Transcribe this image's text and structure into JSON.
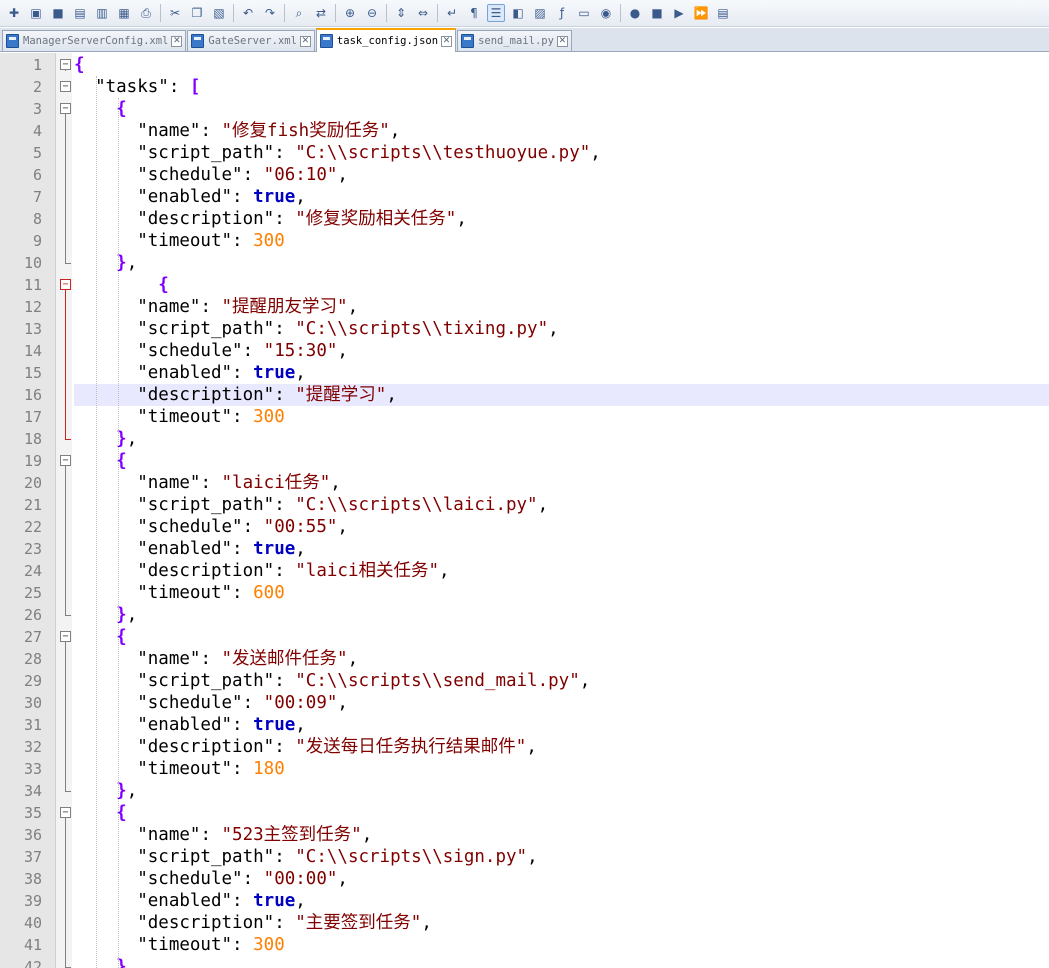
{
  "toolbar": {
    "buttons": [
      {
        "icon": "new-file-icon",
        "glyph": "✚"
      },
      {
        "icon": "open-file-icon",
        "glyph": "▣"
      },
      {
        "icon": "save-icon",
        "glyph": "■"
      },
      {
        "icon": "save-all-icon",
        "glyph": "▤"
      },
      {
        "icon": "close-icon",
        "glyph": "▥"
      },
      {
        "icon": "close-all-icon",
        "glyph": "▦"
      },
      {
        "icon": "print-icon",
        "glyph": "⎙"
      },
      {
        "sep": true
      },
      {
        "icon": "cut-icon",
        "glyph": "✂"
      },
      {
        "icon": "copy-icon",
        "glyph": "❐"
      },
      {
        "icon": "paste-icon",
        "glyph": "▧"
      },
      {
        "sep": true
      },
      {
        "icon": "undo-icon",
        "glyph": "↶"
      },
      {
        "icon": "redo-icon",
        "glyph": "↷"
      },
      {
        "sep": true
      },
      {
        "icon": "find-icon",
        "glyph": "⌕"
      },
      {
        "icon": "replace-icon",
        "glyph": "⇄"
      },
      {
        "sep": true
      },
      {
        "icon": "zoom-in-icon",
        "glyph": "⊕"
      },
      {
        "icon": "zoom-out-icon",
        "glyph": "⊖"
      },
      {
        "sep": true
      },
      {
        "icon": "sync-vertical-icon",
        "glyph": "⇕"
      },
      {
        "icon": "sync-horizontal-icon",
        "glyph": "⇔"
      },
      {
        "sep": true
      },
      {
        "icon": "word-wrap-icon",
        "glyph": "↵"
      },
      {
        "icon": "show-all-chars-icon",
        "glyph": "¶"
      },
      {
        "icon": "indent-guide-icon",
        "glyph": "☰",
        "active": true
      },
      {
        "icon": "user-language-icon",
        "glyph": "◧"
      },
      {
        "icon": "doc-map-icon",
        "glyph": "▨"
      },
      {
        "icon": "function-list-icon",
        "glyph": "ƒ"
      },
      {
        "icon": "folder-workspace-icon",
        "glyph": "▭"
      },
      {
        "icon": "monitoring-icon",
        "glyph": "◉"
      },
      {
        "sep": true
      },
      {
        "icon": "record-macro-icon",
        "glyph": "●"
      },
      {
        "icon": "stop-macro-icon",
        "glyph": "■"
      },
      {
        "icon": "play-macro-icon",
        "glyph": "▶"
      },
      {
        "icon": "run-macro-multiple-icon",
        "glyph": "⏩"
      },
      {
        "icon": "save-macro-icon",
        "glyph": "▤"
      }
    ]
  },
  "tabs": [
    {
      "label": "ManagerServerConfig.xml",
      "active": false
    },
    {
      "label": "GateServer.xml",
      "active": false
    },
    {
      "label": "task_config.json",
      "active": true
    },
    {
      "label": "send_mail.py",
      "active": false
    }
  ],
  "editor": {
    "current_line": 16,
    "lines": [
      {
        "n": "1",
        "fold": "-",
        "tokens": [
          [
            "b",
            "{"
          ]
        ]
      },
      {
        "n": "2",
        "fold": "-",
        "tokens": [
          [
            "p",
            "  "
          ],
          [
            "k",
            "\"tasks\""
          ],
          [
            "p",
            ": "
          ],
          [
            "b",
            "["
          ]
        ]
      },
      {
        "n": "3",
        "fold": "-",
        "tokens": [
          [
            "p",
            "    "
          ],
          [
            "b",
            "{"
          ]
        ]
      },
      {
        "n": "4",
        "tokens": [
          [
            "p",
            "      "
          ],
          [
            "k",
            "\"name\""
          ],
          [
            "p",
            ": "
          ],
          [
            "s",
            "\"修复fish奖励任务\""
          ],
          [
            "p",
            ","
          ]
        ]
      },
      {
        "n": "5",
        "tokens": [
          [
            "p",
            "      "
          ],
          [
            "k",
            "\"script_path\""
          ],
          [
            "p",
            ": "
          ],
          [
            "s",
            "\"C:\\\\scripts\\\\testhuoyue.py\""
          ],
          [
            "p",
            ","
          ]
        ]
      },
      {
        "n": "6",
        "tokens": [
          [
            "p",
            "      "
          ],
          [
            "k",
            "\"schedule\""
          ],
          [
            "p",
            ": "
          ],
          [
            "s",
            "\"06:10\""
          ],
          [
            "p",
            ","
          ]
        ]
      },
      {
        "n": "7",
        "tokens": [
          [
            "p",
            "      "
          ],
          [
            "k",
            "\"enabled\""
          ],
          [
            "p",
            ": "
          ],
          [
            "t",
            "true"
          ],
          [
            "p",
            ","
          ]
        ]
      },
      {
        "n": "8",
        "tokens": [
          [
            "p",
            "      "
          ],
          [
            "k",
            "\"description\""
          ],
          [
            "p",
            ": "
          ],
          [
            "s",
            "\"修复奖励相关任务\""
          ],
          [
            "p",
            ","
          ]
        ]
      },
      {
        "n": "9",
        "tokens": [
          [
            "p",
            "      "
          ],
          [
            "k",
            "\"timeout\""
          ],
          [
            "p",
            ": "
          ],
          [
            "n",
            "300"
          ]
        ]
      },
      {
        "n": "10",
        "tokens": [
          [
            "p",
            "    "
          ],
          [
            "b",
            "}"
          ],
          [
            "p",
            ","
          ]
        ]
      },
      {
        "n": "11",
        "fold": "-r",
        "tokens": [
          [
            "p",
            "        "
          ],
          [
            "b",
            "{"
          ]
        ]
      },
      {
        "n": "12",
        "tokens": [
          [
            "p",
            "      "
          ],
          [
            "k",
            "\"name\""
          ],
          [
            "p",
            ": "
          ],
          [
            "s",
            "\"提醒朋友学习\""
          ],
          [
            "p",
            ","
          ]
        ]
      },
      {
        "n": "13",
        "tokens": [
          [
            "p",
            "      "
          ],
          [
            "k",
            "\"script_path\""
          ],
          [
            "p",
            ": "
          ],
          [
            "s",
            "\"C:\\\\scripts\\\\tixing.py\""
          ],
          [
            "p",
            ","
          ]
        ]
      },
      {
        "n": "14",
        "tokens": [
          [
            "p",
            "      "
          ],
          [
            "k",
            "\"schedule\""
          ],
          [
            "p",
            ": "
          ],
          [
            "s",
            "\"15:30\""
          ],
          [
            "p",
            ","
          ]
        ]
      },
      {
        "n": "15",
        "tokens": [
          [
            "p",
            "      "
          ],
          [
            "k",
            "\"enabled\""
          ],
          [
            "p",
            ": "
          ],
          [
            "t",
            "true"
          ],
          [
            "p",
            ","
          ]
        ]
      },
      {
        "n": "16",
        "tokens": [
          [
            "p",
            "      "
          ],
          [
            "k",
            "\"description\""
          ],
          [
            "p",
            ": "
          ],
          [
            "s",
            "\"提醒学习\""
          ],
          [
            "p",
            ","
          ]
        ]
      },
      {
        "n": "17",
        "tokens": [
          [
            "p",
            "      "
          ],
          [
            "k",
            "\"timeout\""
          ],
          [
            "p",
            ": "
          ],
          [
            "n",
            "300"
          ]
        ]
      },
      {
        "n": "18",
        "tokens": [
          [
            "p",
            "    "
          ],
          [
            "b",
            "}"
          ],
          [
            "p",
            ","
          ]
        ]
      },
      {
        "n": "19",
        "fold": "-",
        "tokens": [
          [
            "p",
            "    "
          ],
          [
            "b",
            "{"
          ]
        ]
      },
      {
        "n": "20",
        "tokens": [
          [
            "p",
            "      "
          ],
          [
            "k",
            "\"name\""
          ],
          [
            "p",
            ": "
          ],
          [
            "s",
            "\"laici任务\""
          ],
          [
            "p",
            ","
          ]
        ]
      },
      {
        "n": "21",
        "tokens": [
          [
            "p",
            "      "
          ],
          [
            "k",
            "\"script_path\""
          ],
          [
            "p",
            ": "
          ],
          [
            "s",
            "\"C:\\\\scripts\\\\laici.py\""
          ],
          [
            "p",
            ","
          ]
        ]
      },
      {
        "n": "22",
        "tokens": [
          [
            "p",
            "      "
          ],
          [
            "k",
            "\"schedule\""
          ],
          [
            "p",
            ": "
          ],
          [
            "s",
            "\"00:55\""
          ],
          [
            "p",
            ","
          ]
        ]
      },
      {
        "n": "23",
        "tokens": [
          [
            "p",
            "      "
          ],
          [
            "k",
            "\"enabled\""
          ],
          [
            "p",
            ": "
          ],
          [
            "t",
            "true"
          ],
          [
            "p",
            ","
          ]
        ]
      },
      {
        "n": "24",
        "tokens": [
          [
            "p",
            "      "
          ],
          [
            "k",
            "\"description\""
          ],
          [
            "p",
            ": "
          ],
          [
            "s",
            "\"laici相关任务\""
          ],
          [
            "p",
            ","
          ]
        ]
      },
      {
        "n": "25",
        "tokens": [
          [
            "p",
            "      "
          ],
          [
            "k",
            "\"timeout\""
          ],
          [
            "p",
            ": "
          ],
          [
            "n",
            "600"
          ]
        ]
      },
      {
        "n": "26",
        "tokens": [
          [
            "p",
            "    "
          ],
          [
            "b",
            "}"
          ],
          [
            "p",
            ","
          ]
        ]
      },
      {
        "n": "27",
        "fold": "-",
        "tokens": [
          [
            "p",
            "    "
          ],
          [
            "b",
            "{"
          ]
        ]
      },
      {
        "n": "28",
        "tokens": [
          [
            "p",
            "      "
          ],
          [
            "k",
            "\"name\""
          ],
          [
            "p",
            ": "
          ],
          [
            "s",
            "\"发送邮件任务\""
          ],
          [
            "p",
            ","
          ]
        ]
      },
      {
        "n": "29",
        "tokens": [
          [
            "p",
            "      "
          ],
          [
            "k",
            "\"script_path\""
          ],
          [
            "p",
            ": "
          ],
          [
            "s",
            "\"C:\\\\scripts\\\\send_mail.py\""
          ],
          [
            "p",
            ","
          ]
        ]
      },
      {
        "n": "30",
        "tokens": [
          [
            "p",
            "      "
          ],
          [
            "k",
            "\"schedule\""
          ],
          [
            "p",
            ": "
          ],
          [
            "s",
            "\"00:09\""
          ],
          [
            "p",
            ","
          ]
        ]
      },
      {
        "n": "31",
        "tokens": [
          [
            "p",
            "      "
          ],
          [
            "k",
            "\"enabled\""
          ],
          [
            "p",
            ": "
          ],
          [
            "t",
            "true"
          ],
          [
            "p",
            ","
          ]
        ]
      },
      {
        "n": "32",
        "tokens": [
          [
            "p",
            "      "
          ],
          [
            "k",
            "\"description\""
          ],
          [
            "p",
            ": "
          ],
          [
            "s",
            "\"发送每日任务执行结果邮件\""
          ],
          [
            "p",
            ","
          ]
        ]
      },
      {
        "n": "33",
        "tokens": [
          [
            "p",
            "      "
          ],
          [
            "k",
            "\"timeout\""
          ],
          [
            "p",
            ": "
          ],
          [
            "n",
            "180"
          ]
        ]
      },
      {
        "n": "34",
        "tokens": [
          [
            "p",
            "    "
          ],
          [
            "b",
            "}"
          ],
          [
            "p",
            ","
          ]
        ]
      },
      {
        "n": "35",
        "fold": "-",
        "tokens": [
          [
            "p",
            "    "
          ],
          [
            "b",
            "{"
          ]
        ]
      },
      {
        "n": "36",
        "tokens": [
          [
            "p",
            "      "
          ],
          [
            "k",
            "\"name\""
          ],
          [
            "p",
            ": "
          ],
          [
            "s",
            "\"523主签到任务\""
          ],
          [
            "p",
            ","
          ]
        ]
      },
      {
        "n": "37",
        "tokens": [
          [
            "p",
            "      "
          ],
          [
            "k",
            "\"script_path\""
          ],
          [
            "p",
            ": "
          ],
          [
            "s",
            "\"C:\\\\scripts\\\\sign.py\""
          ],
          [
            "p",
            ","
          ]
        ]
      },
      {
        "n": "38",
        "tokens": [
          [
            "p",
            "      "
          ],
          [
            "k",
            "\"schedule\""
          ],
          [
            "p",
            ": "
          ],
          [
            "s",
            "\"00:00\""
          ],
          [
            "p",
            ","
          ]
        ]
      },
      {
        "n": "39",
        "tokens": [
          [
            "p",
            "      "
          ],
          [
            "k",
            "\"enabled\""
          ],
          [
            "p",
            ": "
          ],
          [
            "t",
            "true"
          ],
          [
            "p",
            ","
          ]
        ]
      },
      {
        "n": "40",
        "tokens": [
          [
            "p",
            "      "
          ],
          [
            "k",
            "\"description\""
          ],
          [
            "p",
            ": "
          ],
          [
            "s",
            "\"主要签到任务\""
          ],
          [
            "p",
            ","
          ]
        ]
      },
      {
        "n": "41",
        "tokens": [
          [
            "p",
            "      "
          ],
          [
            "k",
            "\"timeout\""
          ],
          [
            "p",
            ": "
          ],
          [
            "n",
            "300"
          ]
        ]
      },
      {
        "n": "42",
        "tokens": [
          [
            "p",
            "    "
          ],
          [
            "b",
            "}"
          ]
        ]
      }
    ]
  }
}
